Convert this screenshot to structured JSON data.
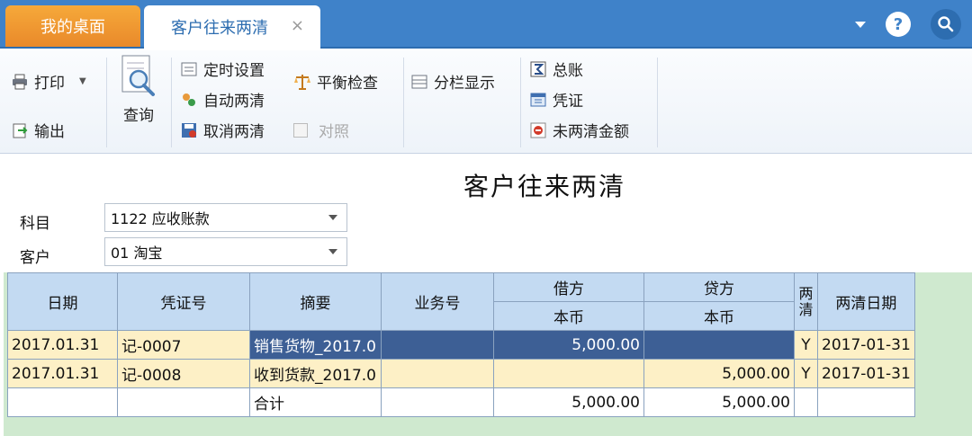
{
  "tabs": {
    "home": "我的桌面",
    "active": "客户往来两清",
    "close": "×"
  },
  "top_icons": {
    "help": "?"
  },
  "toolbar": {
    "print": "打印",
    "export": "输出",
    "query": "查询",
    "timed_settings": "定时设置",
    "auto_clear": "自动两清",
    "cancel_clear": "取消两清",
    "balance_check": "平衡检查",
    "reconcile": "对照",
    "split_display": "分栏显示",
    "general_ledger": "总账",
    "voucher": "凭证",
    "uncleared_amount": "未两清金额"
  },
  "report": {
    "title": "客户往来两清",
    "subject_label": "科目",
    "subject_value": "1122 应收账款",
    "customer_label": "客户",
    "customer_value": "01 淘宝"
  },
  "grid": {
    "headers": {
      "date": "日期",
      "voucher_no": "凭证号",
      "summary": "摘要",
      "business_no": "业务号",
      "debit": "借方",
      "debit_sub": "本币",
      "credit": "贷方",
      "credit_sub": "本币",
      "cleared": "两清",
      "clear_date": "两清日期"
    },
    "rows": [
      {
        "date": "2017.01.31",
        "voucher_no": "记-0007",
        "summary": "销售货物_2017.0",
        "business_no": "",
        "debit": "5,000.00",
        "credit": "",
        "cleared": "Y",
        "clear_date": "2017-01-31"
      },
      {
        "date": "2017.01.31",
        "voucher_no": "记-0008",
        "summary": "收到货款_2017.0",
        "business_no": "",
        "debit": "",
        "credit": "5,000.00",
        "cleared": "Y",
        "clear_date": "2017-01-31"
      }
    ],
    "total": {
      "label": "合计",
      "debit": "5,000.00",
      "credit": "5,000.00"
    }
  }
}
